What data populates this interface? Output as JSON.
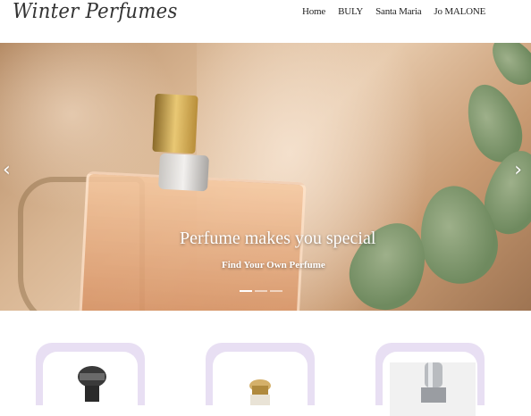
{
  "header": {
    "logo": "Winter Perfumes",
    "nav": [
      "Home",
      "BULY",
      "Santa Maria",
      "Jo MALONE"
    ]
  },
  "hero": {
    "title": "Perfume makes you special",
    "subtitle": "Find Your Own Perfume",
    "slides": 3,
    "active_slide": 1,
    "prev_icon": "chevron-left-icon",
    "next_icon": "chevron-right-icon"
  },
  "products": [
    {
      "name": "dark-perfume-bottle"
    },
    {
      "name": "gold-cap-perfume-bottle"
    },
    {
      "name": "silver-perfume-bottle"
    }
  ],
  "colors": {
    "card_border": "#e8dff3",
    "text": "#222222"
  }
}
